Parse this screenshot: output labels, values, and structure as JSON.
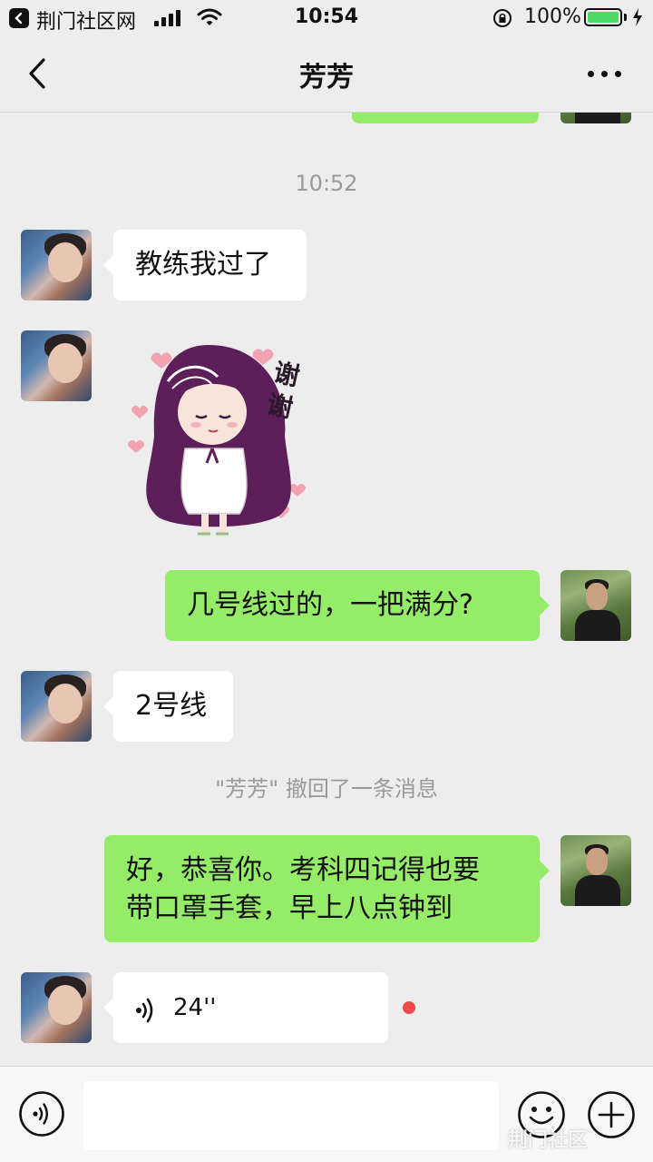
{
  "status_bar": {
    "carrier": "荆门社区网",
    "time": "10:54",
    "battery_percent": "100%",
    "battery_level": 1.0
  },
  "header": {
    "title": "芳芳",
    "back_icon": "chevron-left-icon",
    "more_icon": "more-icon"
  },
  "messages": {
    "timestamp": "10:52",
    "m1": "教练我过了",
    "sticker_text": "谢谢",
    "m2": "几号线过的，一把满分?",
    "m3": "2号线",
    "recall_notice": "\"芳芳\" 撤回了一条消息",
    "m4_line1": "好，恭喜你。考科四记得也要",
    "m4_line2": "带口罩手套，早上八点钟到",
    "voice_duration": "24''"
  },
  "input_bar": {
    "placeholder": "",
    "voice_icon": "voice-icon",
    "emoji_icon": "emoji-icon",
    "plus_icon": "plus-icon"
  },
  "colors": {
    "background": "#ededed",
    "bubble_self": "#95ec69",
    "bubble_peer": "#ffffff",
    "unread_dot": "#f04a4a",
    "battery": "#4cd964"
  }
}
